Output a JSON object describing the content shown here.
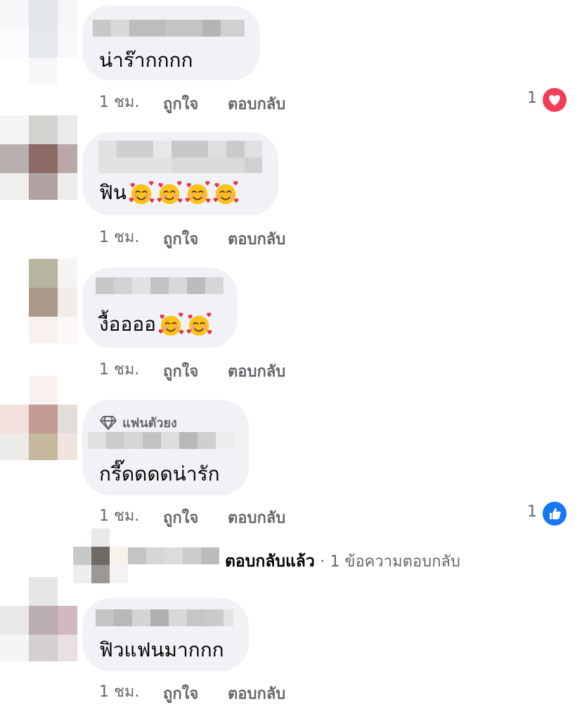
{
  "comments": [
    {
      "text": "น่าร๊ากกกก",
      "time": "1 ชม.",
      "like": "ถูกใจ",
      "reply": "ตอบกลับ",
      "reaction_count": "1",
      "reaction": "love-icon",
      "emoji_count": 0
    },
    {
      "text": "ฟิน",
      "time": "1 ชม.",
      "like": "ถูกใจ",
      "reply": "ตอบกลับ",
      "emoji_count": 4,
      "emoji": "smiling-face-with-hearts-icon"
    },
    {
      "text": "งื้ออออ",
      "time": "1 ชม.",
      "like": "ถูกใจ",
      "reply": "ตอบกลับ",
      "emoji_count": 2,
      "emoji": "smiling-face-with-hearts-icon"
    },
    {
      "badge": "แฟนตัวยง",
      "badge_icon": "diamond-icon",
      "text": "กรี๊ดดดดน่ารัก",
      "time": "1 ชม.",
      "like": "ถูกใจ",
      "reply": "ตอบกลับ",
      "reaction_count": "1",
      "reaction": "like-icon",
      "emoji_count": 0
    },
    {
      "text": "ฟิวแฟนมากกก",
      "time": "1 ชม.",
      "like": "ถูกใจ",
      "reply": "ตอบกลับ",
      "emoji_count": 0
    }
  ],
  "reply_thread": {
    "replied": "ตอบกลับแล้ว",
    "separator": "·",
    "count_text": "1 ข้อความตอบกลับ"
  },
  "colors": {
    "bubble": "#f0f2f5",
    "meta": "#65676b",
    "love": "#f33e58",
    "like": "#1877f2"
  }
}
